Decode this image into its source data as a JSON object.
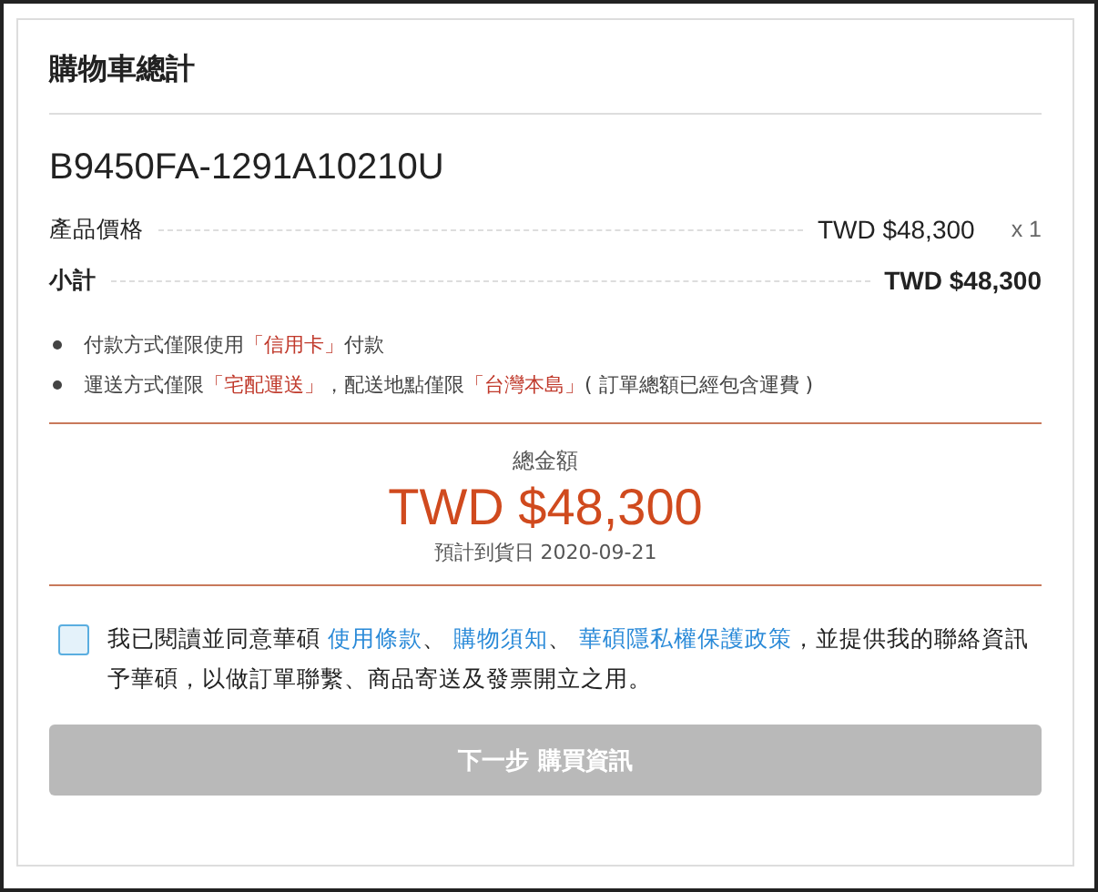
{
  "title": "購物車總計",
  "product": {
    "model": "B9450FA-1291A10210U",
    "price_label": "產品價格",
    "price": "TWD $48,300",
    "quantity": "x 1",
    "subtotal_label": "小計",
    "subtotal": "TWD $48,300"
  },
  "notes": [
    [
      {
        "text": "付款方式僅限使用",
        "highlight": false
      },
      {
        "text": "「信用卡」",
        "highlight": true
      },
      {
        "text": "付款",
        "highlight": false
      }
    ],
    [
      {
        "text": "運送方式僅限",
        "highlight": false
      },
      {
        "text": "「宅配運送」",
        "highlight": true
      },
      {
        "text": "，配送地點僅限",
        "highlight": false
      },
      {
        "text": "「台灣本島」",
        "highlight": true
      },
      {
        "text": "( 訂單總額已經包含運費 )",
        "highlight": false
      }
    ]
  ],
  "total": {
    "label": "總金額",
    "amount": "TWD $48,300",
    "delivery": "預計到貨日 2020-09-21"
  },
  "agreement": {
    "checked": false,
    "parts": [
      {
        "kind": "text",
        "text": "我已閱讀並同意華碩 "
      },
      {
        "kind": "link",
        "text": "使用條款"
      },
      {
        "kind": "text",
        "text": "、 "
      },
      {
        "kind": "link",
        "text": "購物須知"
      },
      {
        "kind": "text",
        "text": "、 "
      },
      {
        "kind": "link",
        "text": "華碩隱私權保護政策"
      },
      {
        "kind": "text",
        "text": "，並提供我的聯絡資訊予華碩，以做訂單聯繫、商品寄送及發票開立之用。"
      }
    ]
  },
  "next_button": {
    "label": "下一步 購買資訊",
    "disabled": true
  }
}
